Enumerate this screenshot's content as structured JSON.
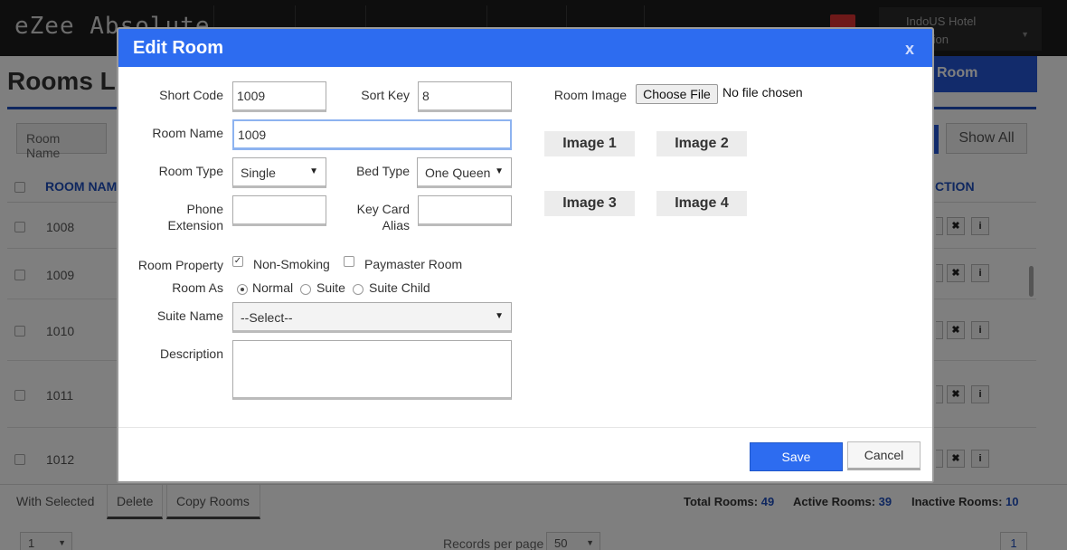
{
  "app": {
    "title": "eZee Absolute",
    "user_line1": "IndoUS Hotel",
    "user_line2": "guration",
    "page_title": "Rooms L",
    "add_button": "Room"
  },
  "filters": {
    "room_name_placeholder": "Room Name",
    "show_all": "Show All"
  },
  "table": {
    "col_room": "ROOM NAM",
    "col_action": "CTION",
    "rows": [
      {
        "room": "1008"
      },
      {
        "room": "1009"
      },
      {
        "room": "1010"
      },
      {
        "room": "1011"
      },
      {
        "room": "1012"
      }
    ]
  },
  "bottom": {
    "with_selected": "With Selected",
    "delete": "Delete",
    "copy_rooms": "Copy Rooms",
    "total_label": "Total Rooms:",
    "total_value": "49",
    "active_label": "Active Rooms:",
    "active_value": "39",
    "inactive_label": "Inactive Rooms:",
    "inactive_value": "10",
    "page_select": "1",
    "records_label": "Records per page",
    "records_value": "50",
    "page_number": "1"
  },
  "modal": {
    "title": "Edit Room",
    "close": "x",
    "short_code_label": "Short Code",
    "short_code_value": "1009",
    "sort_key_label": "Sort Key",
    "sort_key_value": "8",
    "room_name_label": "Room Name",
    "room_name_value": "1009",
    "room_type_label": "Room Type",
    "room_type_value": "Single",
    "bed_type_label": "Bed Type",
    "bed_type_value": "One Queen",
    "phone_label_1": "Phone",
    "phone_label_2": "Extension",
    "phone_value": "",
    "keycard_label_1": "Key Card",
    "keycard_label_2": "Alias",
    "keycard_value": "",
    "room_property_label": "Room Property",
    "non_smoking_label": "Non-Smoking",
    "non_smoking_checked": true,
    "paymaster_label": "Paymaster Room",
    "paymaster_checked": false,
    "room_as_label": "Room As",
    "room_as_options": [
      "Normal",
      "Suite",
      "Suite Child"
    ],
    "room_as_selected": "Normal",
    "suite_name_label": "Suite Name",
    "suite_name_value": "--Select--",
    "description_label": "Description",
    "room_image_label": "Room Image",
    "choose_file": "Choose File",
    "file_status": "No file chosen",
    "images": [
      "Image 1",
      "Image 2",
      "Image 3",
      "Image 4"
    ],
    "save": "Save",
    "cancel": "Cancel"
  },
  "colors": {
    "accent": "#2d6cf0",
    "link_blue": "#1e4fbf",
    "topbar": "#1c1c1c"
  }
}
